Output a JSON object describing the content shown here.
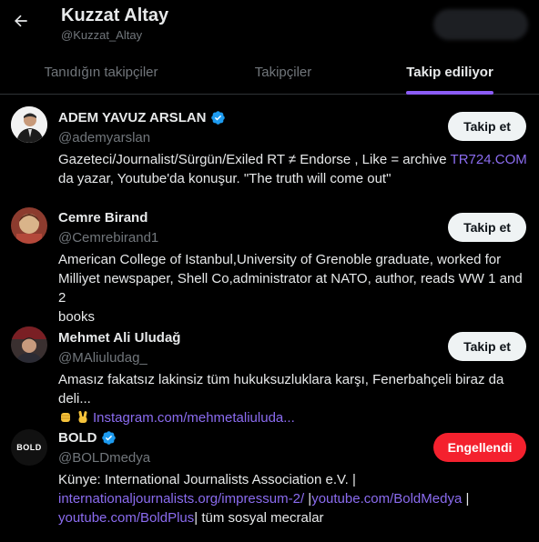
{
  "header": {
    "title": "Kuzzat Altay",
    "handle": "@Kuzzat_Altay"
  },
  "tabs": [
    {
      "label": "Tanıdığın takipçiler",
      "active": false
    },
    {
      "label": "Takipçiler",
      "active": false
    },
    {
      "label": "Takip ediliyor",
      "active": true
    }
  ],
  "accent_color": "#8b5cf6",
  "users": [
    {
      "name": "ADEM YAVUZ ARSLAN",
      "handle": "@ademyarslan",
      "verified": true,
      "bio_text": "Gazeteci/Journalist/Sürgün/Exiled RT ≠ Endorse , Like = archive ",
      "bio_link": "TR724.COM",
      "bio_line2": "da yazar, Youtube'da konuşur. \"The truth will come out\"",
      "button": "Takip et"
    },
    {
      "name": "Cemre Birand",
      "handle": "@Cemrebirand1",
      "verified": false,
      "bio_line1": "American College of Istanbul,University of Grenoble graduate, worked for",
      "bio_line2": "Milliyet newspaper, Shell Co,administrator at NATO, author, reads WW 1 and 2",
      "bio_line3": "books",
      "button": "Takip et"
    },
    {
      "name": "Mehmet Ali Uludağ",
      "handle": "@MAliuludag_",
      "verified": false,
      "bio_line1": "Amasız fakatsız lakinsiz tüm hukuksuzluklara karşı, Fenerbahçeli biraz da deli...",
      "bio_link": "Instagram.com/mehmetaliuluda...",
      "button": "Takip et"
    },
    {
      "name": "BOLD",
      "handle": "@BOLDmedya",
      "verified": true,
      "avatar_text": "BOLD",
      "bio_line1": "Künye: International Journalists Association e.V. |",
      "bio_link1": "internationaljournalists.org/impressum-2/",
      "bio_sep1": " |",
      "bio_link2": "youtube.com/BoldMedya",
      "bio_sep2": " |",
      "bio_link3": "youtube.com/BoldPlus",
      "bio_tail": "| tüm sosyal mecralar",
      "button": "Engellendi"
    }
  ]
}
